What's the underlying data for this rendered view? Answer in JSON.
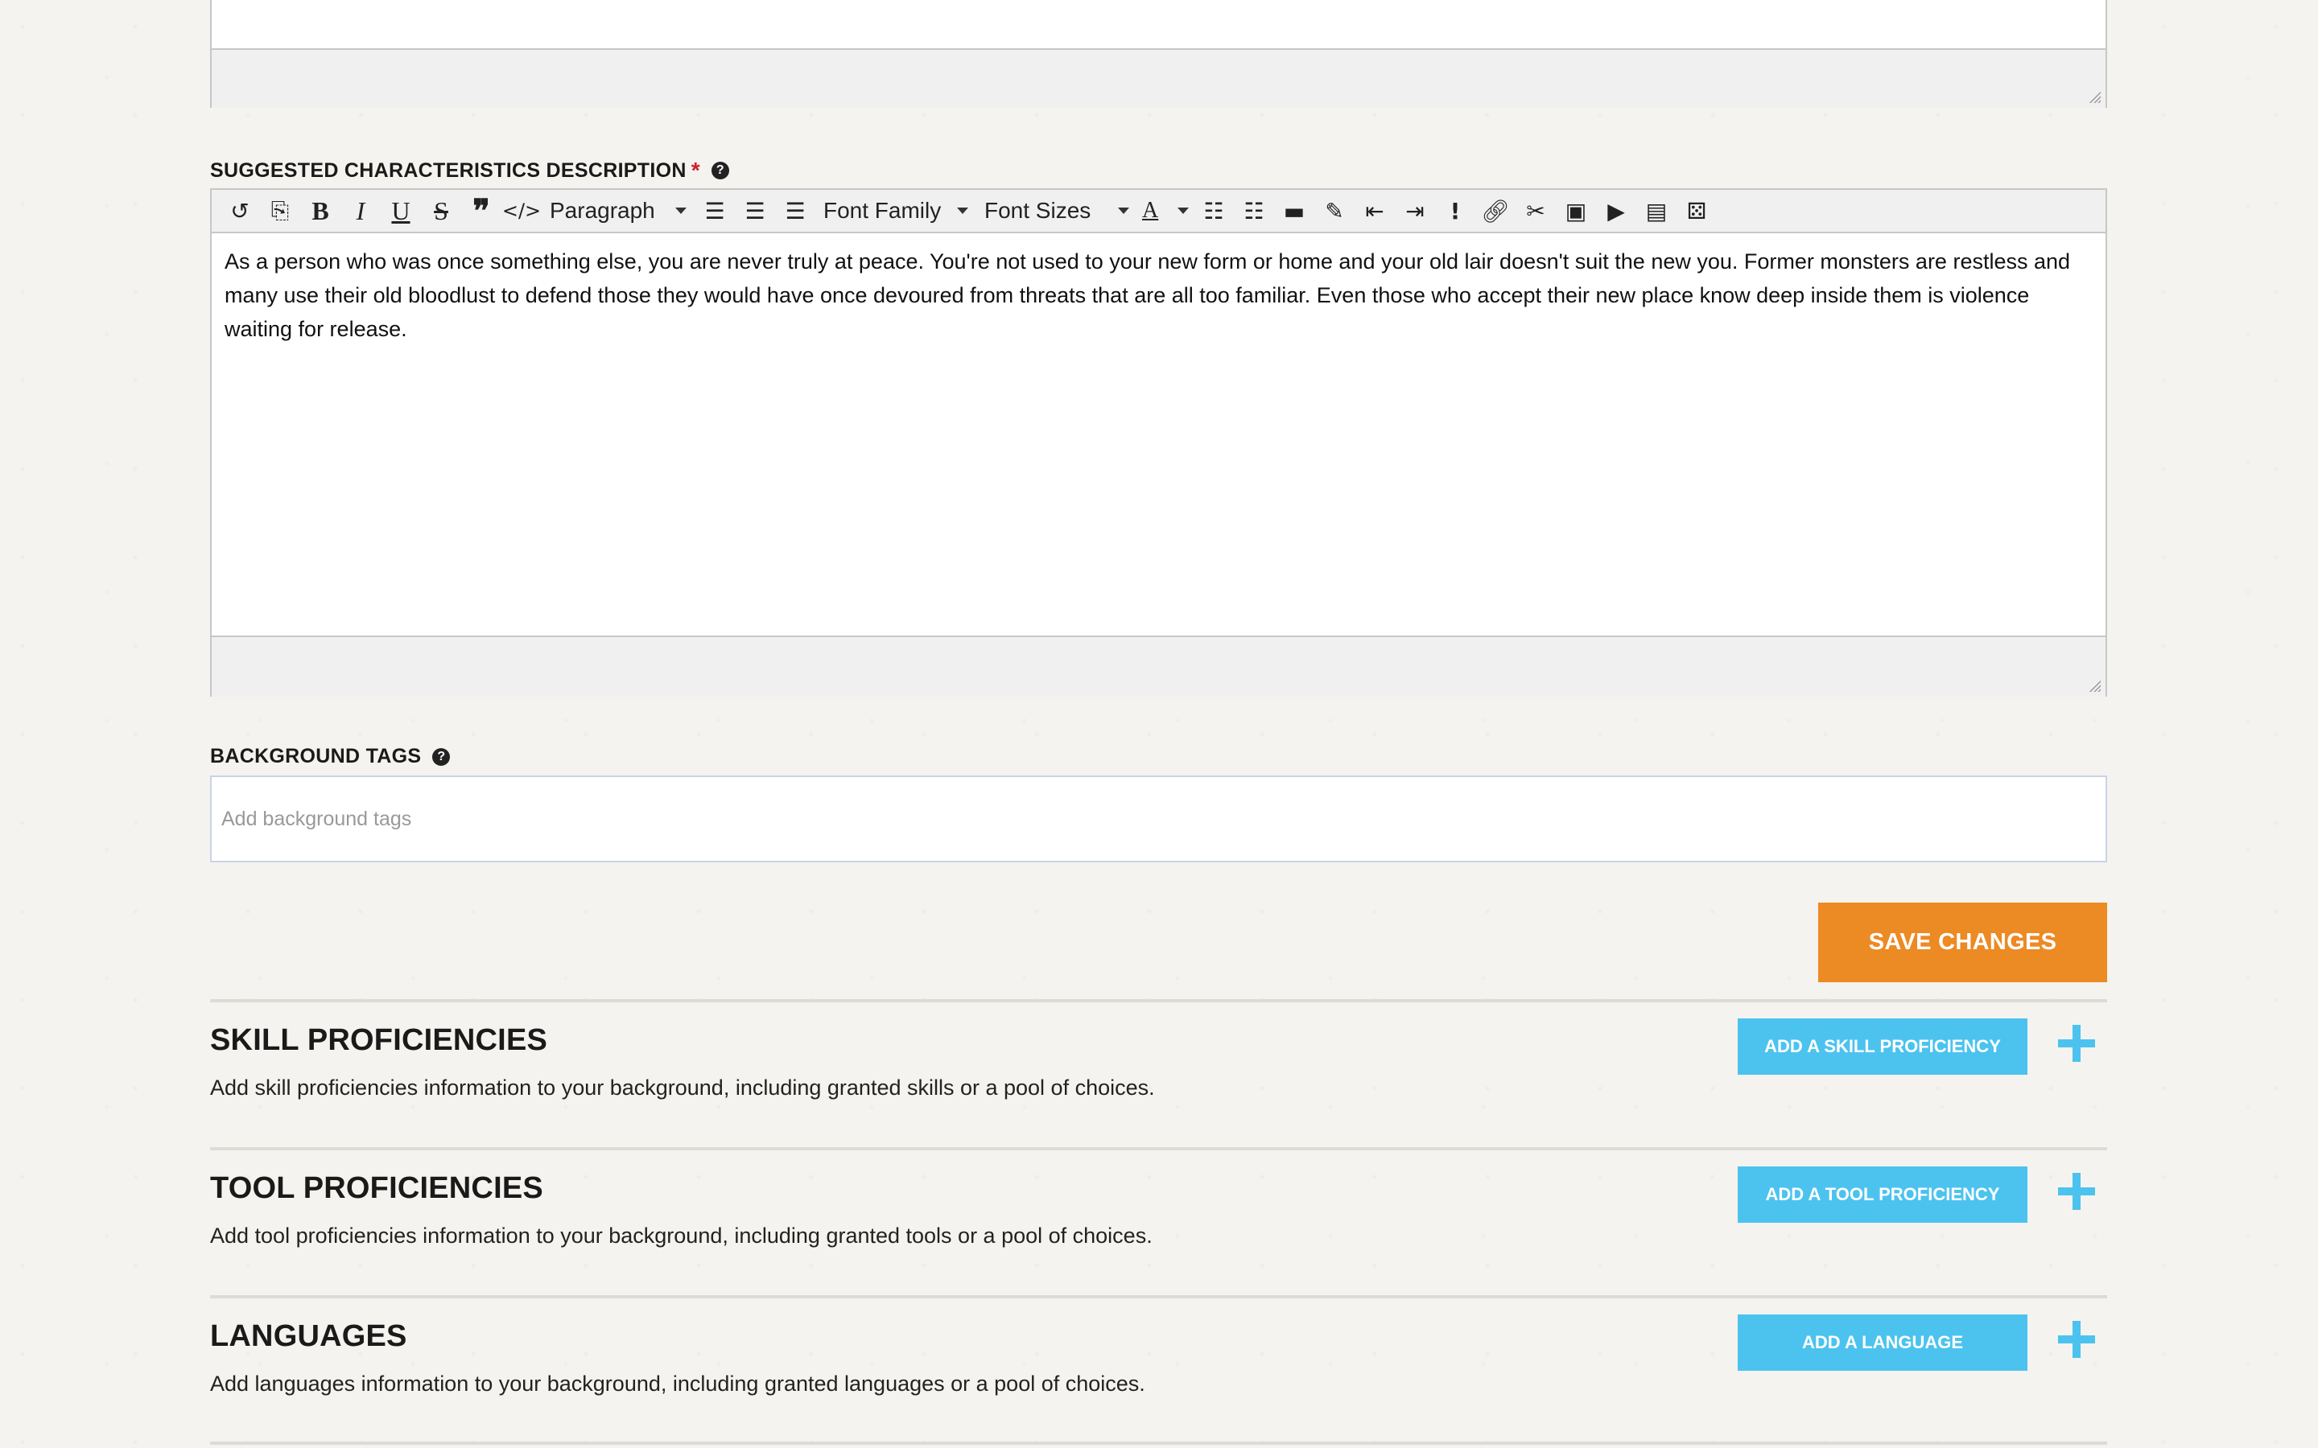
{
  "characteristics": {
    "label": "Suggested Characteristics Description",
    "required_mark": "*",
    "help": "?",
    "text": "As a person who was once something else, you are never truly at peace. You're not used to your new form or home and your old lair doesn't suit the new you. Former monsters are restless and many use their old bloodlust to defend those they would have once devoured from threats that are all too familiar. Even those who accept their new place know deep inside them is violence waiting for release."
  },
  "toolbar": {
    "format_select": "Paragraph",
    "font_family": "Font Family",
    "font_sizes": "Font Sizes",
    "bold": "B",
    "italic": "I",
    "underline": "U",
    "strike": "S",
    "text_color": "A",
    "exclamation": "!"
  },
  "tags": {
    "label": "Background Tags",
    "help": "?",
    "placeholder": "Add background tags"
  },
  "save_button": "Save Changes",
  "sections": [
    {
      "title": "Skill Proficiencies",
      "description": "Add skill proficiencies information to your background, including granted skills or a pool of choices.",
      "button": "Add a Skill Proficiency"
    },
    {
      "title": "Tool Proficiencies",
      "description": "Add tool proficiencies information to your background, including granted tools or a pool of choices.",
      "button": "Add a Tool Proficiency"
    },
    {
      "title": "Languages",
      "description": "Add languages information to your background, including granted languages or a pool of choices.",
      "button": "Add a Language"
    }
  ],
  "colors": {
    "save": "#ec8a24",
    "add": "#4cc3ef",
    "required": "#d0202a"
  }
}
